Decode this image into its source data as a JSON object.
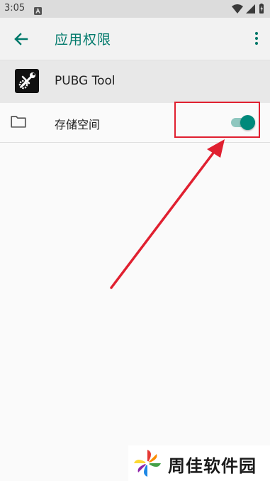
{
  "status_bar": {
    "time": "3:05",
    "icons": [
      "notification-icon",
      "wifi-icon",
      "signal-icon",
      "battery-icon"
    ]
  },
  "app_bar": {
    "title": "应用权限",
    "back_icon": "arrow-back-icon",
    "more_icon": "more-vert-icon",
    "accent_color": "#00796b"
  },
  "app": {
    "name": "PUBG Tool",
    "icon": "wrench-gear-icon"
  },
  "permissions": [
    {
      "icon": "folder-icon",
      "label": "存储空间",
      "enabled": true
    }
  ],
  "annotation": {
    "highlight_color": "#e02030",
    "target": "storage-toggle"
  },
  "watermark": {
    "text": "周佳软件园"
  }
}
